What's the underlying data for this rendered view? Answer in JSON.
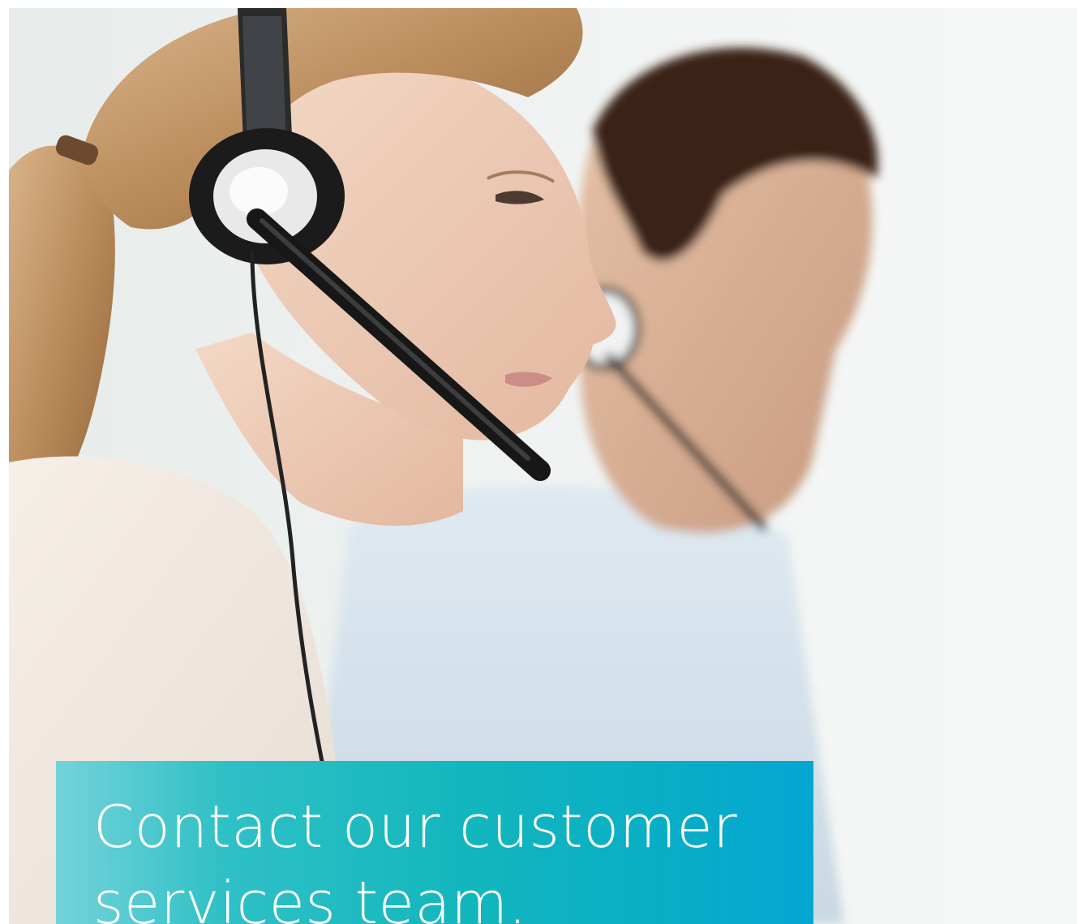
{
  "caption": {
    "line1": "Contact our customer",
    "line2": "services team."
  },
  "colors": {
    "caption_gradient_start": "#74d3d9",
    "caption_gradient_mid": "#12b6bd",
    "caption_gradient_end": "#04a6d2",
    "caption_text": "#ffffff",
    "background": "#eef2f2"
  },
  "photo": {
    "subjects": [
      "woman-with-headset",
      "man-with-headset"
    ]
  }
}
